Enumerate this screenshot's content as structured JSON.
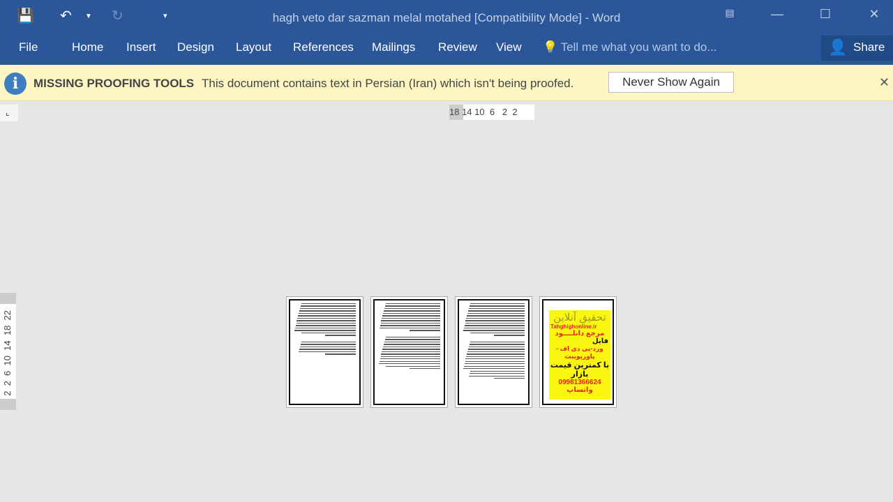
{
  "window": {
    "title": "hagh veto dar sazman melal motahed [Compatibility Mode] - Word",
    "quick_access": [
      "save-icon",
      "undo-icon",
      "redo-icon",
      "customize-icon"
    ],
    "controls": [
      "ribbon-display-icon",
      "minimize-icon",
      "maximize-icon",
      "close-icon"
    ]
  },
  "ribbon": {
    "tabs": [
      "File",
      "Home",
      "Insert",
      "Design",
      "Layout",
      "References",
      "Mailings",
      "Review",
      "View"
    ],
    "tell_me": "Tell me what you want to do...",
    "share": "Share"
  },
  "message_bar": {
    "title": "MISSING PROOFING TOOLS",
    "text": "This document contains text in Persian (Iran) which isn't being proofed.",
    "button": "Never Show Again"
  },
  "rulers": {
    "horizontal": "18 14 10  6   2  2",
    "vertical": "2  2  6  10  14  18  22"
  },
  "ad_page": {
    "title": "تحقیق آنلاین",
    "site": "Tahghighonline.ir",
    "line1": "مرجع دانلــــود",
    "line2": "فایل",
    "line3": "ورد-پی دی اف - پاورپوینت",
    "line4": "با کمترین قیمت بازار",
    "line5": "09981366624 واتساپ"
  },
  "colors": {
    "ribbon": "#2b579a",
    "message_bar": "#fdf6c3",
    "ad_background": "#fbf512"
  }
}
